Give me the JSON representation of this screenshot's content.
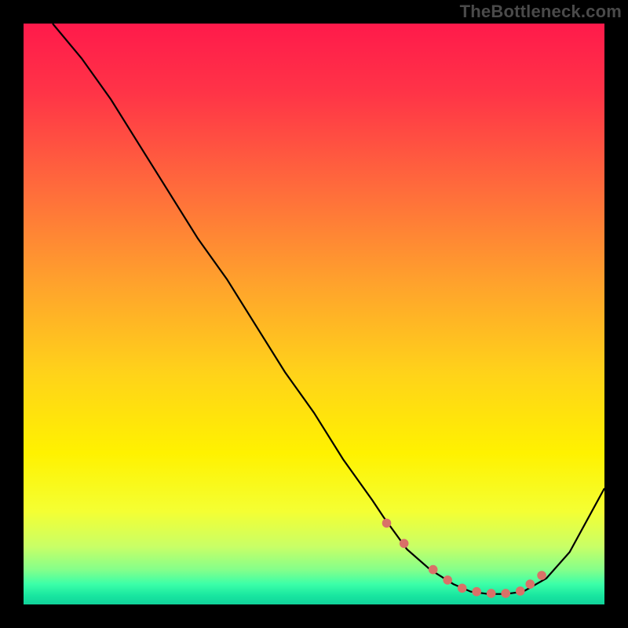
{
  "watermark": "TheBottleneck.com",
  "colors": {
    "frame_bg": "#000000",
    "marker_fill": "#d97168",
    "curve_stroke": "#000000",
    "gradient_stops": [
      {
        "offset": 0.0,
        "color": "#ff1a4b"
      },
      {
        "offset": 0.12,
        "color": "#ff3447"
      },
      {
        "offset": 0.28,
        "color": "#ff6a3c"
      },
      {
        "offset": 0.45,
        "color": "#ffa32c"
      },
      {
        "offset": 0.6,
        "color": "#ffd21a"
      },
      {
        "offset": 0.74,
        "color": "#fff200"
      },
      {
        "offset": 0.84,
        "color": "#f4ff33"
      },
      {
        "offset": 0.9,
        "color": "#c9ff66"
      },
      {
        "offset": 0.94,
        "color": "#85ff8a"
      },
      {
        "offset": 0.965,
        "color": "#3bffa8"
      },
      {
        "offset": 0.985,
        "color": "#18e6a0"
      },
      {
        "offset": 1.0,
        "color": "#11d29a"
      }
    ]
  },
  "chart_data": {
    "type": "line",
    "title": "",
    "xlabel": "",
    "ylabel": "",
    "xlim": [
      0,
      100
    ],
    "ylim": [
      0,
      100
    ],
    "grid": false,
    "series": [
      {
        "name": "bottleneck-curve",
        "x": [
          5,
          10,
          15,
          20,
          25,
          30,
          35,
          40,
          45,
          50,
          55,
          60,
          62,
          66,
          70,
          74,
          77,
          80,
          83,
          86,
          90,
          94,
          100
        ],
        "y": [
          100,
          94,
          87,
          79,
          71,
          63,
          56,
          48,
          40,
          33,
          25,
          18,
          15,
          9.5,
          6,
          3.5,
          2.2,
          1.8,
          1.8,
          2.2,
          4.5,
          9,
          20
        ]
      }
    ],
    "markers": {
      "name": "highlight-points",
      "x": [
        62.5,
        65.5,
        70.5,
        73.0,
        75.5,
        78.0,
        80.5,
        83.0,
        85.5,
        87.2,
        89.2
      ],
      "y": [
        14.0,
        10.5,
        6.0,
        4.2,
        2.8,
        2.2,
        1.9,
        1.9,
        2.3,
        3.5,
        5.0
      ],
      "radius": 5.8
    }
  }
}
